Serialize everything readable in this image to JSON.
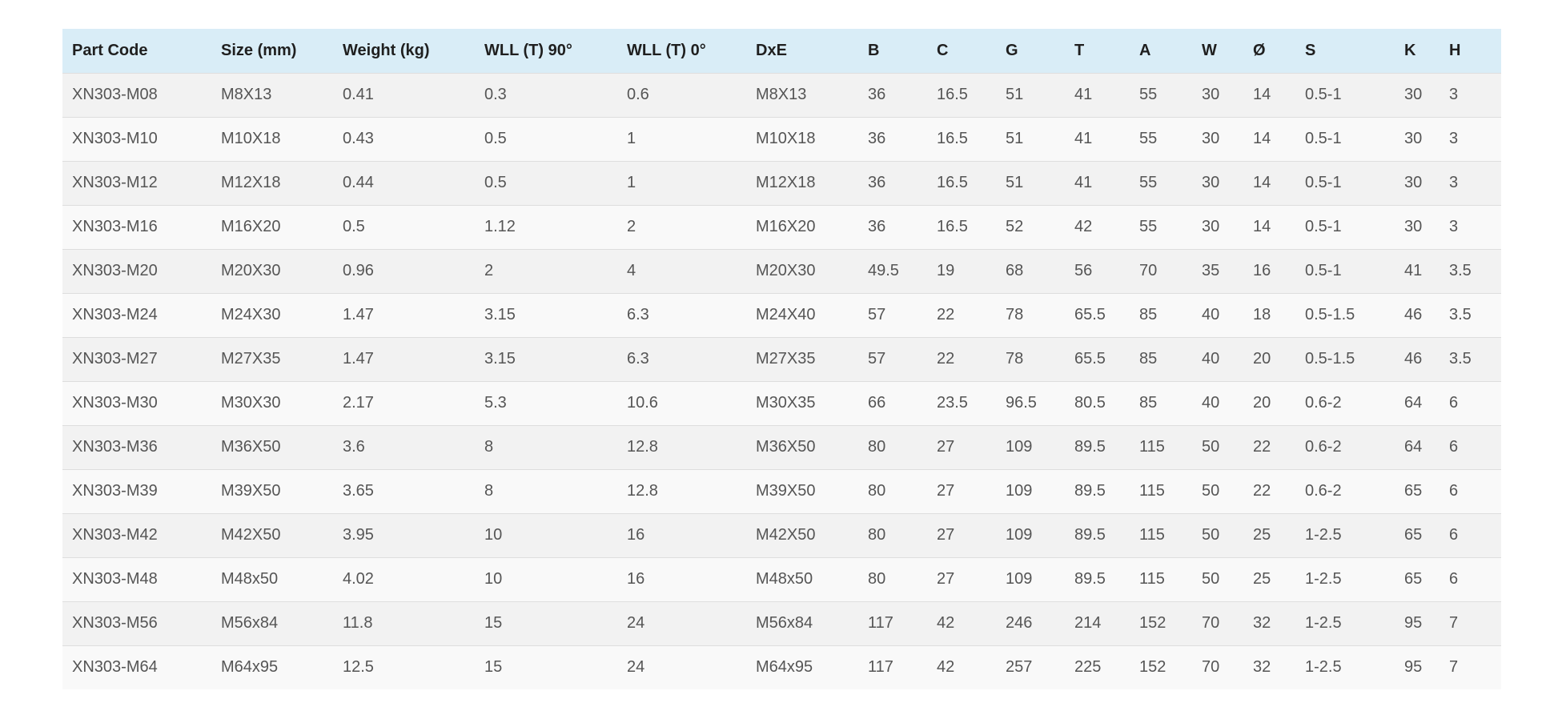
{
  "table": {
    "headers": [
      "Part Code",
      "Size (mm)",
      "Weight (kg)",
      "WLL (T) 90°",
      "WLL (T) 0°",
      "DxE",
      "B",
      "C",
      "G",
      "T",
      "A",
      "W",
      "Ø",
      "S",
      "K",
      "H"
    ],
    "rows": [
      [
        "XN303-M08",
        "M8X13",
        "0.41",
        "0.3",
        "0.6",
        "M8X13",
        "36",
        "16.5",
        "51",
        "41",
        "55",
        "30",
        "14",
        "0.5-1",
        "30",
        "3"
      ],
      [
        "XN303-M10",
        "M10X18",
        "0.43",
        "0.5",
        "1",
        "M10X18",
        "36",
        "16.5",
        "51",
        "41",
        "55",
        "30",
        "14",
        "0.5-1",
        "30",
        "3"
      ],
      [
        "XN303-M12",
        "M12X18",
        "0.44",
        "0.5",
        "1",
        "M12X18",
        "36",
        "16.5",
        "51",
        "41",
        "55",
        "30",
        "14",
        "0.5-1",
        "30",
        "3"
      ],
      [
        "XN303-M16",
        "M16X20",
        "0.5",
        "1.12",
        "2",
        "M16X20",
        "36",
        "16.5",
        "52",
        "42",
        "55",
        "30",
        "14",
        "0.5-1",
        "30",
        "3"
      ],
      [
        "XN303-M20",
        "M20X30",
        "0.96",
        "2",
        "4",
        "M20X30",
        "49.5",
        "19",
        "68",
        "56",
        "70",
        "35",
        "16",
        "0.5-1",
        "41",
        "3.5"
      ],
      [
        "XN303-M24",
        "M24X30",
        "1.47",
        "3.15",
        "6.3",
        "M24X40",
        "57",
        "22",
        "78",
        "65.5",
        "85",
        "40",
        "18",
        "0.5-1.5",
        "46",
        "3.5"
      ],
      [
        "XN303-M27",
        "M27X35",
        "1.47",
        "3.15",
        "6.3",
        "M27X35",
        "57",
        "22",
        "78",
        "65.5",
        "85",
        "40",
        "20",
        "0.5-1.5",
        "46",
        "3.5"
      ],
      [
        "XN303-M30",
        "M30X30",
        "2.17",
        "5.3",
        "10.6",
        "M30X35",
        "66",
        "23.5",
        "96.5",
        "80.5",
        "85",
        "40",
        "20",
        "0.6-2",
        "64",
        "6"
      ],
      [
        "XN303-M36",
        "M36X50",
        "3.6",
        "8",
        "12.8",
        "M36X50",
        "80",
        "27",
        "109",
        "89.5",
        "115",
        "50",
        "22",
        "0.6-2",
        "64",
        "6"
      ],
      [
        "XN303-M39",
        "M39X50",
        "3.65",
        "8",
        "12.8",
        "M39X50",
        "80",
        "27",
        "109",
        "89.5",
        "115",
        "50",
        "22",
        "0.6-2",
        "65",
        "6"
      ],
      [
        "XN303-M42",
        "M42X50",
        "3.95",
        "10",
        "16",
        "M42X50",
        "80",
        "27",
        "109",
        "89.5",
        "115",
        "50",
        "25",
        "1-2.5",
        "65",
        "6"
      ],
      [
        "XN303-M48",
        "M48x50",
        "4.02",
        "10",
        "16",
        "M48x50",
        "80",
        "27",
        "109",
        "89.5",
        "115",
        "50",
        "25",
        "1-2.5",
        "65",
        "6"
      ],
      [
        "XN303-M56",
        "M56x84",
        "11.8",
        "15",
        "24",
        "M56x84",
        "117",
        "42",
        "246",
        "214",
        "152",
        "70",
        "32",
        "1-2.5",
        "95",
        "7"
      ],
      [
        "XN303-M64",
        "M64x95",
        "12.5",
        "15",
        "24",
        "M64x95",
        "117",
        "42",
        "257",
        "225",
        "152",
        "70",
        "32",
        "1-2.5",
        "95",
        "7"
      ]
    ]
  }
}
